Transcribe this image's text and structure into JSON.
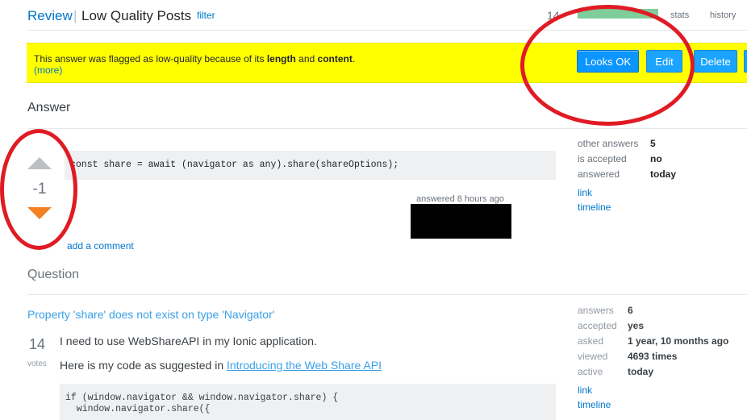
{
  "header": {
    "review_link": "Review",
    "separator": "|",
    "title": "Low Quality Posts",
    "filter": "filter",
    "count": "14",
    "stats": "stats",
    "history": "history"
  },
  "banner": {
    "text_prefix": "This answer was flagged as low-quality because of its ",
    "length": "length",
    "and": " and ",
    "content": "content",
    "period": ".",
    "more": "(more)",
    "buttons": {
      "looks_ok": "Looks OK",
      "edit": "Edit",
      "delete": "Delete"
    }
  },
  "answer": {
    "section_title": "Answer",
    "vote_count": "-1",
    "code": "const share = await (navigator as any).share(shareOptions);",
    "answered_text": "answered 8 hours ago",
    "add_comment": "add a comment",
    "side": {
      "other_answers_label": "other answers",
      "other_answers_value": "5",
      "accepted_label": "is accepted",
      "accepted_value": "no",
      "answered_label": "answered",
      "answered_value": "today",
      "link": "link",
      "timeline": "timeline"
    }
  },
  "question": {
    "section_title": "Question",
    "title": "Property 'share' does not exist on type 'Navigator'",
    "votes": "14",
    "votes_label": "votes",
    "body_1": "I need to use WebShareAPI in my Ionic application.",
    "body_2_prefix": "Here is my code as suggested in ",
    "body_2_link": "Introducing the Web Share API",
    "code_line_1": "if (window.navigator && window.navigator.share) {",
    "code_line_2": "  window.navigator.share({",
    "side": {
      "answers_label": "answers",
      "answers_value": "6",
      "accepted_label": "accepted",
      "accepted_value": "yes",
      "asked_label": "asked",
      "asked_value": "1 year, 10 months ago",
      "viewed_label": "viewed",
      "viewed_value": "4693 times",
      "active_label": "active",
      "active_value": "today",
      "link": "link",
      "timeline": "timeline"
    }
  },
  "colors": {
    "banner_bg": "#ffff00",
    "primary_button": "#0a95ff",
    "link": "#0077cc",
    "annotation_red": "#e01b24",
    "downvote_active": "#f48024",
    "progress_green": "#7fcd9a"
  },
  "icons": {
    "upvote": "upvote-arrow-icon",
    "downvote": "downvote-arrow-icon"
  }
}
